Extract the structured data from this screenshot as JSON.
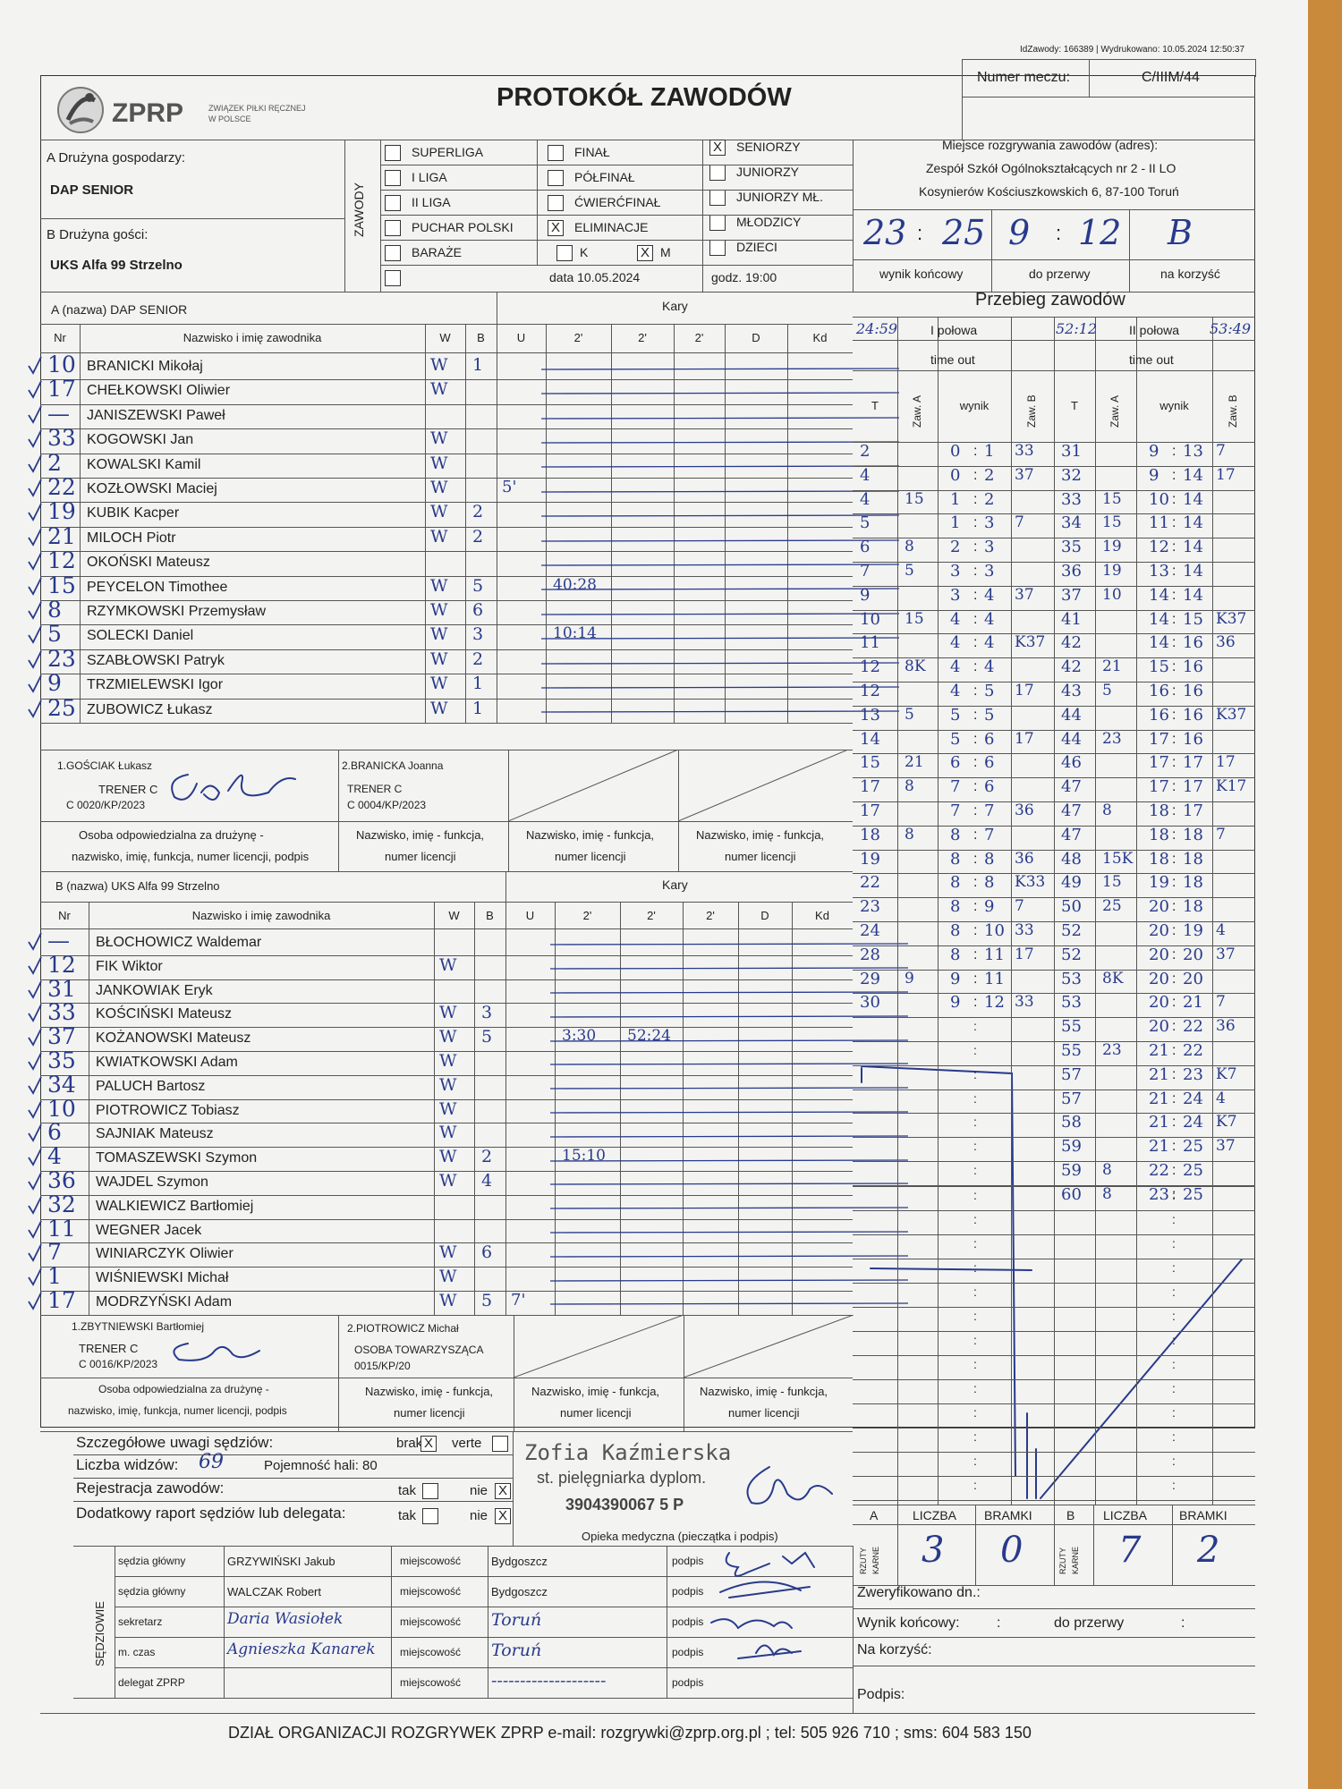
{
  "meta": {
    "id_label": "IdZawody: 166389 | Wydrukowano: 10.05.2024 12:50:37"
  },
  "header": {
    "logo_text": "ZPRP",
    "logo_sub1": "ZWIĄZEK PIŁKI RĘCZNEJ",
    "logo_sub2": "W POLSCE",
    "title": "PROTOKÓŁ ZAWODÓW",
    "match_no_label": "Numer meczu:",
    "match_no": "C/IIIM/44"
  },
  "teams": {
    "home_label": "A Drużyna gospodarzy:",
    "home_name": "DAP SENIOR",
    "away_label": "B Drużyna gości:",
    "away_name": "UKS Alfa 99 Strzelno"
  },
  "competition": {
    "vertical_label": "ZAWODY",
    "col1": [
      "SUPERLIGA",
      "I LIGA",
      "II LIGA",
      "PUCHAR POLSKI",
      "BARAŻE"
    ],
    "col2": [
      "FINAŁ",
      "PÓŁFINAŁ",
      "ĆWIERĆFINAŁ",
      "ELIMINACJE"
    ],
    "col3": [
      "SENIORZY",
      "JUNIORZY",
      "JUNIORZY MŁ.",
      "MŁODZICY",
      "DZIECI"
    ],
    "k_label": "K",
    "m_label": "M",
    "x_mark": "X",
    "date": "data 10.05.2024",
    "time": "godz. 19:00"
  },
  "venue": {
    "label": "Miejsce rozgrywania zawodów (adres):",
    "line1": "Zespół Szkół Ogólnokształcących nr 2 - II LO",
    "line2": "Kosynierów Kościuszkowskich 6, 87-100 Toruń"
  },
  "score": {
    "final_a": "23",
    "final_b": "25",
    "half_a": "9",
    "half_b": "12",
    "winner": "B",
    "colon": ":",
    "final_label": "wynik końcowy",
    "half_label": "do przerwy",
    "winner_label": "na korzyść"
  },
  "home_section": {
    "title": "A (nazwa) DAP SENIOR",
    "kary": "Kary",
    "headers": [
      "Nr",
      "Nazwisko i imię zawodnika",
      "W",
      "B",
      "U",
      "2'",
      "2'",
      "2'",
      "D",
      "Kd"
    ],
    "players": [
      {
        "nr": "10",
        "name": "BRANICKI Mikołaj",
        "w": "W",
        "b": "1",
        "u": "",
        "p1": ""
      },
      {
        "nr": "17",
        "name": "CHEŁKOWSKI Oliwier",
        "w": "W",
        "b": "",
        "u": "",
        "p1": ""
      },
      {
        "nr": "—",
        "name": "JANISZEWSKI Paweł",
        "w": "",
        "b": "",
        "u": "",
        "p1": ""
      },
      {
        "nr": "33",
        "name": "KOGOWSKI Jan",
        "w": "W",
        "b": "",
        "u": "",
        "p1": ""
      },
      {
        "nr": "2",
        "name": "KOWALSKI Kamil",
        "w": "W",
        "b": "",
        "u": "",
        "p1": ""
      },
      {
        "nr": "22",
        "name": "KOZŁOWSKI Maciej",
        "w": "W",
        "b": "",
        "u": "5'",
        "p1": ""
      },
      {
        "nr": "19",
        "name": "KUBIK Kacper",
        "w": "W",
        "b": "2",
        "u": "",
        "p1": ""
      },
      {
        "nr": "21",
        "name": "MILOCH Piotr",
        "w": "W",
        "b": "2",
        "u": "",
        "p1": ""
      },
      {
        "nr": "12",
        "name": "OKOŃSKI Mateusz",
        "w": "",
        "b": "",
        "u": "",
        "p1": ""
      },
      {
        "nr": "15",
        "name": "PEYCELON Timothee",
        "w": "W",
        "b": "5",
        "u": "",
        "p1": "40:28"
      },
      {
        "nr": "8",
        "name": "RZYMKOWSKI Przemysław",
        "w": "W",
        "b": "6",
        "u": "",
        "p1": ""
      },
      {
        "nr": "5",
        "name": "SOLECKI Daniel",
        "w": "W",
        "b": "3",
        "u": "",
        "p1": "10:14"
      },
      {
        "nr": "23",
        "name": "SZABŁOWSKI Patryk",
        "w": "W",
        "b": "2",
        "u": "",
        "p1": ""
      },
      {
        "nr": "9",
        "name": "TRZMIELEWSKI Igor",
        "w": "W",
        "b": "1",
        "u": "",
        "p1": ""
      },
      {
        "nr": "25",
        "name": "ZUBOWICZ Łukasz",
        "w": "W",
        "b": "1",
        "u": "",
        "p1": ""
      }
    ],
    "official1": {
      "name": "1.GOŚCIAK Łukasz",
      "role": "TRENER C",
      "lic": "C  0020/KP/2023"
    },
    "official2": {
      "name": "2.BRANICKA Joanna",
      "role": "TRENER C",
      "lic": "C  0004/KP/2023"
    },
    "resp_l1": "Osoba odpowiedzialna za drużynę -",
    "resp_l2": "nazwisko, imię, funkcja, numer licencji, podpis",
    "nif_l1": "Nazwisko, imię - funkcja,",
    "nif_l2": "numer licencji"
  },
  "away_section": {
    "title": "B (nazwa) UKS Alfa 99 Strzelno",
    "players": [
      {
        "nr": "—",
        "name": "BŁOCHOWICZ Waldemar",
        "w": "",
        "b": "",
        "u": "",
        "p1": "",
        "p2": ""
      },
      {
        "nr": "12",
        "name": "FIK Wiktor",
        "w": "W",
        "b": "",
        "u": "",
        "p1": "",
        "p2": ""
      },
      {
        "nr": "31",
        "name": "JANKOWIAK Eryk",
        "w": "",
        "b": "",
        "u": "",
        "p1": "",
        "p2": ""
      },
      {
        "nr": "33",
        "name": "KOŚCIŃSKI Mateusz",
        "w": "W",
        "b": "3",
        "u": "",
        "p1": "",
        "p2": ""
      },
      {
        "nr": "37",
        "name": "KOŻANOWSKI Mateusz",
        "w": "W",
        "b": "5",
        "u": "",
        "p1": "3:30",
        "p2": "52:24"
      },
      {
        "nr": "35",
        "name": "KWIATKOWSKI Adam",
        "w": "W",
        "b": "",
        "u": "",
        "p1": "",
        "p2": ""
      },
      {
        "nr": "34",
        "name": "PALUCH Bartosz",
        "w": "W",
        "b": "",
        "u": "",
        "p1": "",
        "p2": ""
      },
      {
        "nr": "10",
        "name": "PIOTROWICZ Tobiasz",
        "w": "W",
        "b": "",
        "u": "",
        "p1": "",
        "p2": ""
      },
      {
        "nr": "6",
        "name": "SAJNIAK Mateusz",
        "w": "W",
        "b": "",
        "u": "",
        "p1": "",
        "p2": ""
      },
      {
        "nr": "4",
        "name": "TOMASZEWSKI Szymon",
        "w": "W",
        "b": "2",
        "u": "",
        "p1": "15:10",
        "p2": ""
      },
      {
        "nr": "36",
        "name": "WAJDEL Szymon",
        "w": "W",
        "b": "4",
        "u": "",
        "p1": "",
        "p2": ""
      },
      {
        "nr": "32",
        "name": "WALKIEWICZ Bartłomiej",
        "w": "",
        "b": "",
        "u": "",
        "p1": "",
        "p2": ""
      },
      {
        "nr": "11",
        "name": "WEGNER Jacek",
        "w": "",
        "b": "",
        "u": "",
        "p1": "",
        "p2": ""
      },
      {
        "nr": "7",
        "name": "WINIARCZYK Oliwier",
        "w": "W",
        "b": "6",
        "u": "",
        "p1": "",
        "p2": ""
      },
      {
        "nr": "1",
        "name": "WIŚNIEWSKI Michał",
        "w": "W",
        "b": "",
        "u": "",
        "p1": "",
        "p2": ""
      },
      {
        "nr": "17",
        "name": "MODRZYŃSKI Adam",
        "w": "W",
        "b": "5",
        "u": "7'",
        "p1": "",
        "p2": ""
      }
    ],
    "official1": {
      "name": "1.ZBYTNIEWSKI Bartłomiej",
      "role": "TRENER C",
      "lic": "C  0016/KP/2023"
    },
    "official2": {
      "name": "2.PIOTROWICZ Michał",
      "role": "OSOBA TOWARZYSZĄCA",
      "lic": "0015/KP/20"
    },
    "resp_l1": "Osoba odpowiedzialna za drużynę -",
    "resp_l2": "nazwisko, imię, funkcja, numer licencji, podpis"
  },
  "remarks": {
    "detailed": "Szczegółowe uwagi sędziów:",
    "brak": "brak",
    "verte": "verte",
    "spectators_label": "Liczba widzów:",
    "spectators": "69",
    "capacity": "Pojemność hali: 80",
    "registration": "Rejestracja zawodów:",
    "report": "Dodatkowy raport sędziów lub delegata:",
    "tak": "tak",
    "nie": "nie"
  },
  "medical": {
    "stamp1": "Zofia Kaźmierska",
    "stamp2": "st. pielęgniarka dyplom.",
    "stamp3": "3904390067 5 P",
    "label": "Opieka medyczna (pieczątka i podpis)"
  },
  "referees": {
    "vertical": "SĘDZIOWIE",
    "rows": [
      {
        "role": "sędzia główny",
        "name": "GRZYWIŃSKI Jakub",
        "place": "Bydgoszcz"
      },
      {
        "role": "sędzia główny",
        "name": "WALCZAK Robert",
        "place": "Bydgoszcz"
      },
      {
        "role": "sekretarz",
        "name": "Daria Wasiołek",
        "place": "Toruń"
      },
      {
        "role": "m. czas",
        "name": "Agnieszka Kanarek",
        "place": "Toruń"
      },
      {
        "role": "delegat ZPRP",
        "name": "",
        "place": "--------------------"
      }
    ],
    "place_label": "miejscowość",
    "sign_label": "podpis"
  },
  "progress": {
    "title": "Przebieg zawodów",
    "h1_start": "24:59",
    "h1_label": "I połowa",
    "h1_end": "52:12",
    "h2_label": "II połowa",
    "h2_end": "53:49",
    "timeout": "time out",
    "cols": [
      "T",
      "Zaw. A",
      "wynik",
      "Zaw. B"
    ],
    "half1": [
      [
        "2",
        "",
        "0",
        "1",
        "33"
      ],
      [
        "4",
        "",
        "0",
        "2",
        "37"
      ],
      [
        "4",
        "15",
        "1",
        "2",
        ""
      ],
      [
        "5",
        "",
        "1",
        "3",
        "7"
      ],
      [
        "6",
        "8",
        "2",
        "3",
        ""
      ],
      [
        "7",
        "5",
        "3",
        "3",
        ""
      ],
      [
        "9",
        "",
        "3",
        "4",
        "37"
      ],
      [
        "10",
        "15",
        "4",
        "4",
        ""
      ],
      [
        "11",
        "",
        "4",
        "4",
        "K37"
      ],
      [
        "12",
        "8K",
        "4",
        "4",
        ""
      ],
      [
        "12",
        "",
        "4",
        "5",
        "17"
      ],
      [
        "13",
        "5",
        "5",
        "5",
        ""
      ],
      [
        "14",
        "",
        "5",
        "6",
        "17"
      ],
      [
        "15",
        "21",
        "6",
        "6",
        ""
      ],
      [
        "17",
        "8",
        "7",
        "6",
        ""
      ],
      [
        "17",
        "",
        "7",
        "7",
        "36"
      ],
      [
        "18",
        "8",
        "8",
        "7",
        ""
      ],
      [
        "19",
        "",
        "8",
        "8",
        "36"
      ],
      [
        "22",
        "",
        "8",
        "8",
        "K33"
      ],
      [
        "23",
        "",
        "8",
        "9",
        "7"
      ],
      [
        "24",
        "",
        "8",
        "10",
        "33"
      ],
      [
        "28",
        "",
        "8",
        "11",
        "17"
      ],
      [
        "29",
        "9",
        "9",
        "11",
        ""
      ],
      [
        "30",
        "",
        "9",
        "12",
        "33"
      ]
    ],
    "half2": [
      [
        "31",
        "",
        "9",
        "13",
        "7"
      ],
      [
        "32",
        "",
        "9",
        "14",
        "17"
      ],
      [
        "33",
        "15",
        "10",
        "14",
        ""
      ],
      [
        "34",
        "15",
        "11",
        "14",
        ""
      ],
      [
        "35",
        "19",
        "12",
        "14",
        ""
      ],
      [
        "36",
        "19",
        "13",
        "14",
        ""
      ],
      [
        "37",
        "10",
        "14",
        "14",
        ""
      ],
      [
        "41",
        "",
        "14",
        "15",
        "K37"
      ],
      [
        "42",
        "",
        "14",
        "16",
        "36"
      ],
      [
        "42",
        "21",
        "15",
        "16",
        ""
      ],
      [
        "43",
        "5",
        "16",
        "16",
        ""
      ],
      [
        "44",
        "",
        "16",
        "16",
        "K37"
      ],
      [
        "44",
        "23",
        "17",
        "16",
        ""
      ],
      [
        "46",
        "",
        "17",
        "17",
        "17"
      ],
      [
        "47",
        "",
        "17",
        "17",
        "K17"
      ],
      [
        "47",
        "8",
        "18",
        "17",
        ""
      ],
      [
        "47",
        "",
        "18",
        "18",
        "7"
      ],
      [
        "48",
        "15K",
        "18",
        "18",
        ""
      ],
      [
        "49",
        "15",
        "19",
        "18",
        ""
      ],
      [
        "50",
        "25",
        "20",
        "18",
        ""
      ],
      [
        "52",
        "",
        "20",
        "19",
        "4"
      ],
      [
        "52",
        "",
        "20",
        "20",
        "37"
      ],
      [
        "53",
        "8K",
        "20",
        "20",
        ""
      ],
      [
        "53",
        "",
        "20",
        "21",
        "7"
      ],
      [
        "55",
        "",
        "20",
        "22",
        "36"
      ],
      [
        "55",
        "23",
        "21",
        "22",
        ""
      ],
      [
        "57",
        "",
        "21",
        "23",
        "K7"
      ],
      [
        "57",
        "",
        "21",
        "24",
        "4"
      ],
      [
        "58",
        "",
        "21",
        "24",
        "K7"
      ],
      [
        "59",
        "",
        "21",
        "25",
        "37"
      ],
      [
        "59",
        "8",
        "22",
        "25",
        ""
      ],
      [
        "60",
        "8",
        "23",
        "25",
        ""
      ]
    ]
  },
  "penalties_summary": {
    "a": "A",
    "b": "B",
    "liczba": "LICZBA",
    "bramki": "BRAMKI",
    "rzuty": "RZUTY",
    "karne": "KARNE",
    "a_count": "3",
    "a_goals": "0",
    "b_count": "7",
    "b_goals": "2"
  },
  "verification": {
    "verified": "Zweryfikowano dn.:",
    "final": "Wynik końcowy:",
    "colon": ":",
    "half": "do przerwy",
    "winner": "Na korzyść:",
    "sign": "Podpis:"
  },
  "footer": "DZIAŁ ORGANIZACJI ROZGRYWEK ZPRP e-mail: rozgrywki@zprp.org.pl ; tel: 505 926 710 ; sms: 604 583 150"
}
